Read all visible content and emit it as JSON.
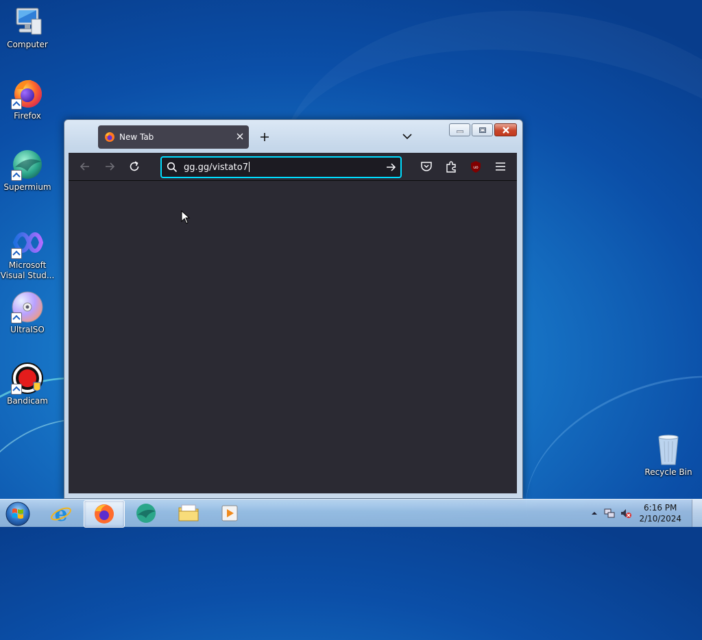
{
  "desktop": {
    "icons": [
      {
        "label": "Computer",
        "icon": "computer-icon"
      },
      {
        "label": "Firefox",
        "icon": "firefox-icon"
      },
      {
        "label": "Supermium",
        "icon": "supermium-icon"
      },
      {
        "label": "Microsoft Visual Stud...",
        "icon": "visual-studio-icon"
      },
      {
        "label": "UltraISO",
        "icon": "ultraiso-icon"
      },
      {
        "label": "Bandicam",
        "icon": "bandicam-icon"
      },
      {
        "label": "Recycle Bin",
        "icon": "recycle-bin-icon"
      }
    ]
  },
  "browser": {
    "tab": {
      "title": "New Tab"
    },
    "url": {
      "value": "gg.gg/vistato7"
    },
    "icons": {
      "back": "arrow-left-icon",
      "forward": "arrow-right-icon",
      "reload": "reload-icon",
      "pocket": "pocket-icon",
      "extensions": "puzzle-icon",
      "ublock": "ublock-origin-icon",
      "menu": "hamburger-menu-icon"
    },
    "accent": "#00ddff",
    "background": "#2b2a33"
  },
  "taskbar": {
    "items": [
      "start-orb-icon",
      "internet-explorer-icon",
      "firefox-icon",
      "supermium-icon",
      "file-explorer-icon",
      "media-player-icon"
    ],
    "clock": {
      "time": "6:16 PM",
      "date": "2/10/2024"
    }
  }
}
